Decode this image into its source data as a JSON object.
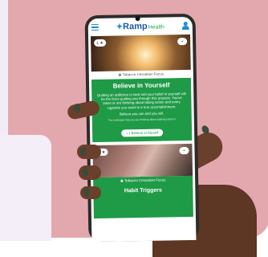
{
  "app": {
    "brand": "Ramp",
    "brand_suffix": "Health"
  },
  "card1": {
    "badge": "1 ★",
    "caption": "Tobacco Cessation Focus",
    "title": "Believe in Yourself",
    "body": "Quitting an addiction is hard and your belief in yourself will be the force guiding you through this process. You've taken or are thinking about taking action and every cigarette you avoid is a true accomplishment.",
    "line2": "Believe you can and you will.",
    "small": "The individual that you are thinking about quitting tobacco",
    "button": "I Believe in Myself"
  },
  "card2": {
    "badge": "1 ★",
    "caption": "Tobacco Cessation Focus",
    "title": "Habit Triggers"
  },
  "colors": {
    "green": "#1f9a47",
    "blue": "#1d8ed3",
    "background": "#e3a8ad"
  }
}
